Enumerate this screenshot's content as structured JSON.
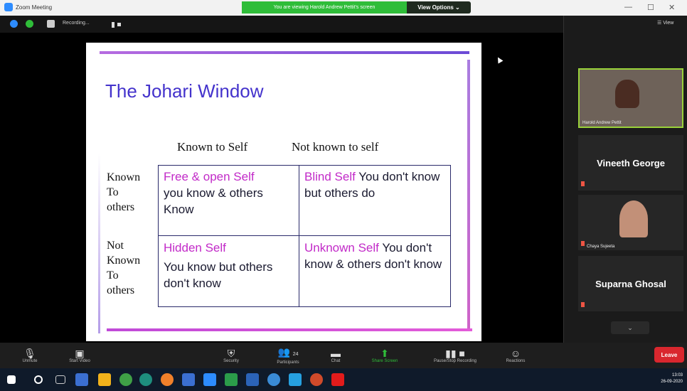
{
  "window": {
    "title": "Zoom Meeting"
  },
  "banner": {
    "sharing_text": "You are viewing Harold Andrew Pettit's screen",
    "view_options": "View Options ⌄"
  },
  "topbar": {
    "recording": "Recording..."
  },
  "slide": {
    "title": "The Johari Window",
    "col_known": "Known to Self",
    "col_not_known": "Not known to self",
    "row1_label": [
      "Known",
      "To",
      "others"
    ],
    "row2_label": [
      "Not",
      "Known",
      "To",
      "others"
    ],
    "cells": {
      "open_title": "Free & open Self",
      "open_body": "you know & others Know",
      "blind_title": "Blind Self",
      "blind_body": "You don't know but others do",
      "hidden_title": "Hidden Self",
      "hidden_body": "You know but others don't know",
      "unknown_title": "Unknown Self",
      "unknown_body": "You don't know & others don't know"
    }
  },
  "sidebar": {
    "view_label": "View",
    "participants": [
      {
        "name": "Harold Andrew Pettit",
        "kind": "video"
      },
      {
        "name": "Vineeth George",
        "kind": "name"
      },
      {
        "name": "Chaya Sujeeta",
        "kind": "avatar"
      },
      {
        "name": "Suparna Ghosal",
        "kind": "name"
      }
    ]
  },
  "toolbar": {
    "unmute": "Unmute",
    "start_video": "Start Video",
    "security": "Security",
    "participants": "Participants",
    "participants_count": "24",
    "chat": "Chat",
    "share_screen": "Share Screen",
    "recording": "Pause/Stop Recording",
    "reactions": "Reactions",
    "leave": "Leave"
  },
  "taskbar": {
    "time": "13:03",
    "date": "26-09-2020"
  },
  "colors": {
    "accent": "#2fbd39",
    "leave": "#d9272e",
    "title": "#4433cc",
    "pink": "#c22ac8"
  }
}
